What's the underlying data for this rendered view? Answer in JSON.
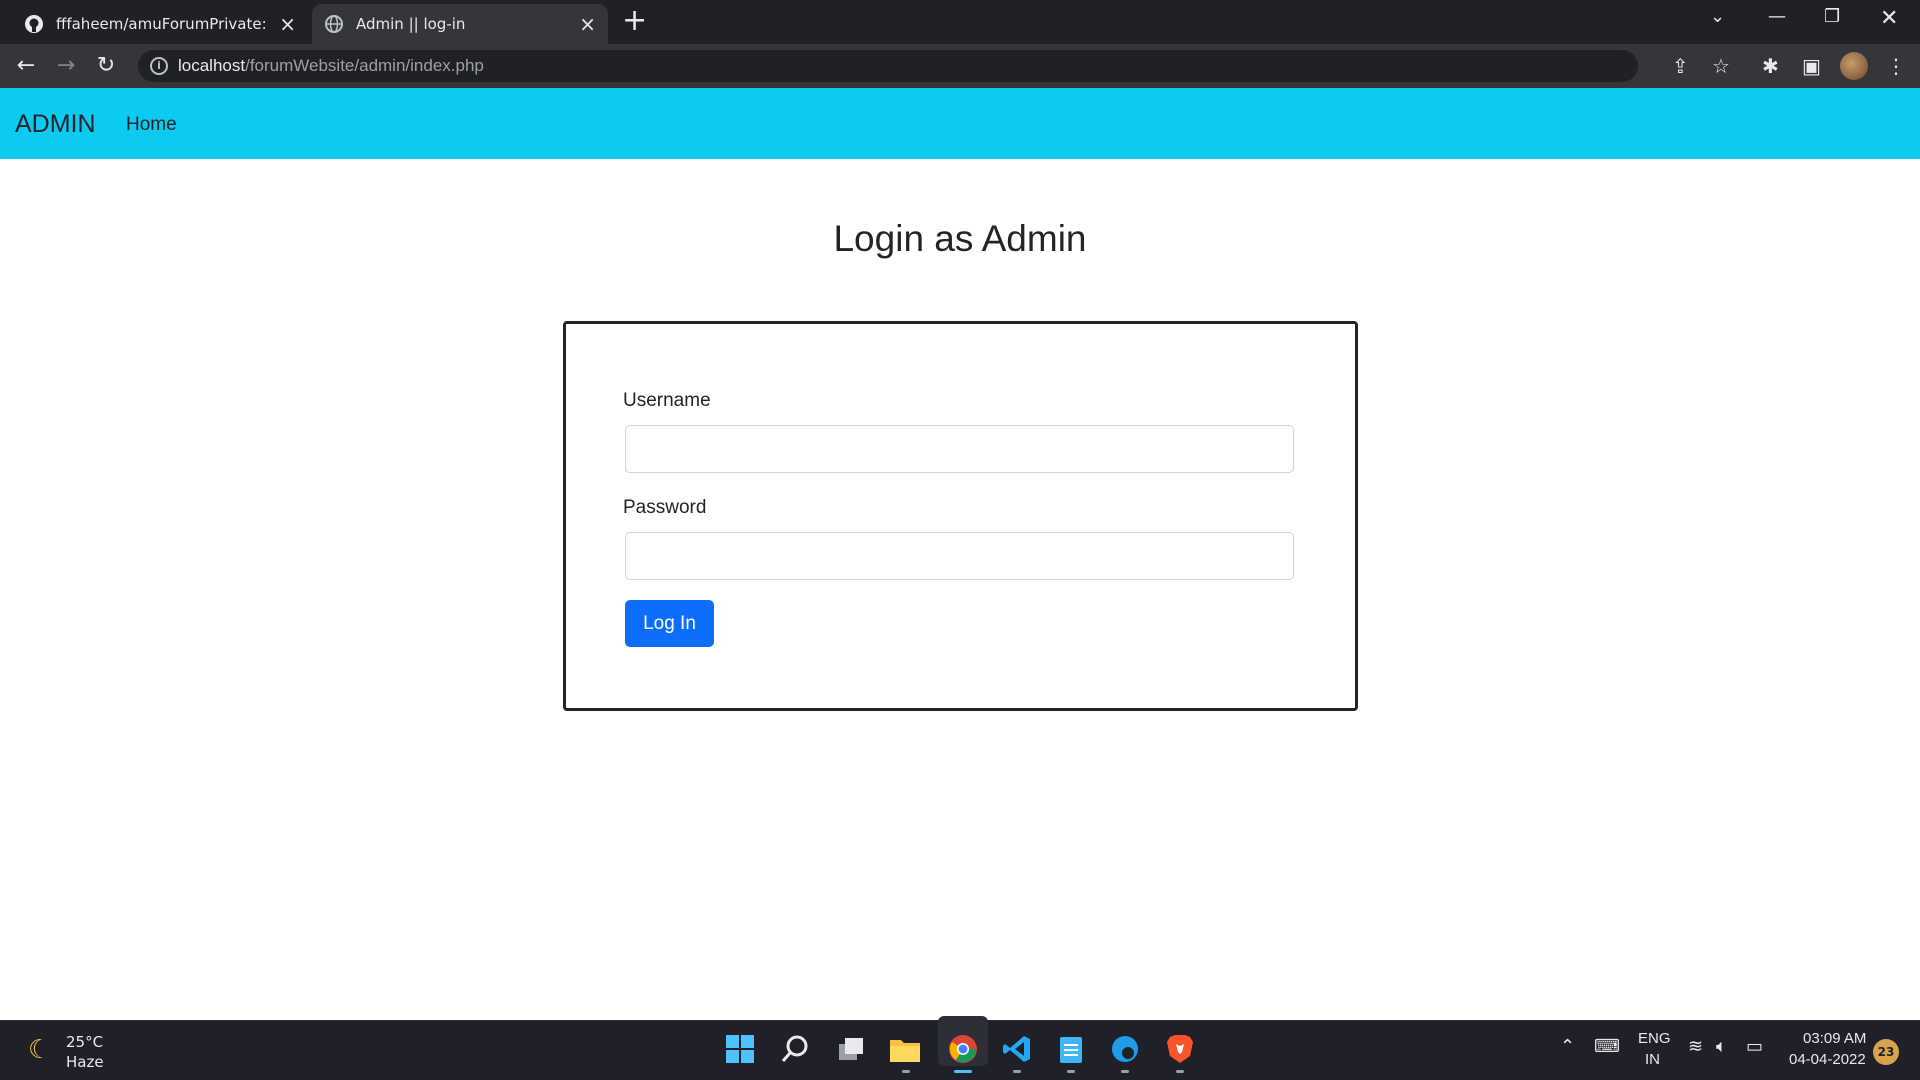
{
  "browser": {
    "tabs": [
      {
        "title": "fffaheem/amuForumPrivate: Foru",
        "icon": "github-icon"
      },
      {
        "title": "Admin || log-in",
        "icon": "globe-icon"
      }
    ],
    "url_host": "localhost",
    "url_path": "/forumWebsite/admin/index.php"
  },
  "navbar": {
    "brand": "ADMIN",
    "home": "Home",
    "color": "#0dcaf0"
  },
  "login": {
    "heading": "Login as Admin",
    "username_label": "Username",
    "username_value": "",
    "password_label": "Password",
    "password_value": "",
    "submit_label": "Log In",
    "button_color": "#0d6efd"
  },
  "taskbar": {
    "weather_temp": "25°C",
    "weather_desc": "Haze",
    "language": "ENG",
    "region": "IN",
    "time": "03:09 AM",
    "date": "04-04-2022",
    "notifications": "23"
  }
}
